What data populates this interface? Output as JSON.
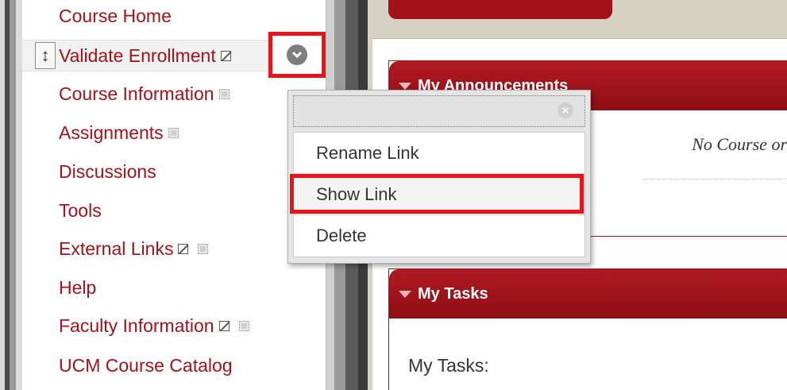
{
  "sidebar": {
    "items": [
      {
        "label": "Course Home"
      },
      {
        "label": "Validate Enrollment"
      },
      {
        "label": "Course Information"
      },
      {
        "label": "Assignments"
      },
      {
        "label": "Discussions"
      },
      {
        "label": "Tools"
      },
      {
        "label": "External Links"
      },
      {
        "label": "Help"
      },
      {
        "label": "Faculty Information"
      },
      {
        "label": "UCM Course Catalog"
      }
    ],
    "drag_handle_glyph": "↕"
  },
  "context_menu": {
    "close_glyph": "×",
    "items": [
      {
        "label": "Rename Link"
      },
      {
        "label": "Show Link"
      },
      {
        "label": "Delete"
      }
    ]
  },
  "modules": {
    "announcements": {
      "title": "My Announcements",
      "body": "No Course or"
    },
    "tasks": {
      "title": "My Tasks",
      "body": "My Tasks:"
    }
  },
  "colors": {
    "brand_red": "#a3121a",
    "highlight_red": "#e8141b"
  },
  "icons": [
    "drag-handle-icon",
    "hidden-icon",
    "unavailable-icon",
    "chevron-down-icon",
    "close-icon",
    "collapse-triangle-icon"
  ]
}
